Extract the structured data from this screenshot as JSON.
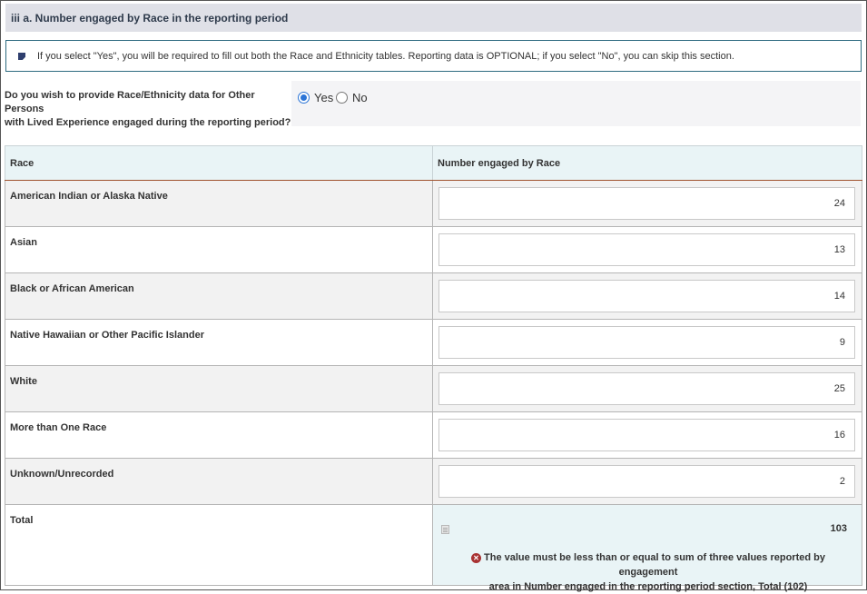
{
  "section": {
    "title": "iii a. Number engaged by Race in the reporting period"
  },
  "info": {
    "text": "If you select \"Yes\", you will be required to fill out both the Race and Ethnicity tables. Reporting data is OPTIONAL; if you select \"No\", you can skip this section."
  },
  "question": {
    "line1": "Do you wish to provide Race/Ethnicity data for Other Persons",
    "line2": "with Lived Experience engaged during the reporting period?",
    "options": [
      {
        "label": "Yes",
        "selected": true
      },
      {
        "label": "No",
        "selected": false
      }
    ]
  },
  "table": {
    "headers": [
      "Race",
      "Number engaged by Race"
    ],
    "rows": [
      {
        "label": "American Indian or Alaska Native",
        "value": "24"
      },
      {
        "label": "Asian",
        "value": "13"
      },
      {
        "label": "Black or African American",
        "value": "14"
      },
      {
        "label": "Native Hawaiian or Other Pacific Islander",
        "value": "9"
      },
      {
        "label": "White",
        "value": "25"
      },
      {
        "label": "More than One Race",
        "value": "16"
      },
      {
        "label": "Unknown/Unrecorded",
        "value": "2"
      }
    ],
    "total": {
      "label": "Total",
      "value": "103",
      "error_line1": "The value must be less than or equal to sum of three values reported by engagement",
      "error_line2": "area in Number engaged in the reporting period section, Total (102)"
    }
  },
  "colors": {
    "accent": "#2b74d6",
    "header_bg": "#dfe0e7",
    "table_header_bg": "#e9f4f6",
    "error": "#a83232"
  }
}
